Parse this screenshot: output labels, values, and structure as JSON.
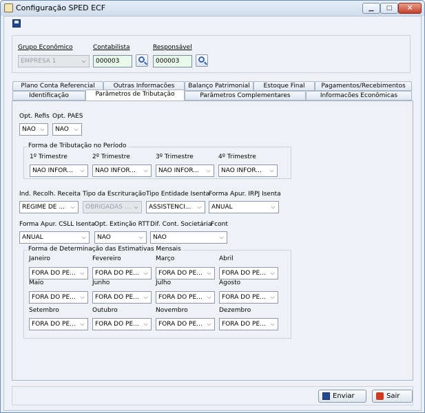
{
  "window": {
    "title": "Configuração SPED ECF",
    "minimize": "▁",
    "maximize": "□",
    "close": "✕"
  },
  "top": {
    "grupo_label": "Grupo Econômico",
    "grupo_value": "EMPRESA 1",
    "contabilista_label": "Contabilista",
    "contabilista_value": "000003",
    "responsavel_label": "Responsável",
    "responsavel_value": "000003"
  },
  "tabs": {
    "row1": [
      "Plano Conta Referencial",
      "Outras Informacões",
      "Balanço Patrimonial",
      "Estoque Final",
      "Pagamentos/Recebimentos"
    ],
    "row2": [
      "Identificação",
      "Parâmetros de Tributação",
      "Parâmetros Complementares",
      "Informacões Econômicas"
    ]
  },
  "form": {
    "opt_refis_label": "Opt. Refis",
    "opt_refis_value": "NAO",
    "opt_paes_label": "Opt. PAES",
    "opt_paes_value": "NAO",
    "forma_trib_title": "Forma de Tributação no Período",
    "trimestres": [
      {
        "label": "1º Trimestre",
        "value": "NAO INFOR..."
      },
      {
        "label": "2º Trimestre",
        "value": "NAO INFOR..."
      },
      {
        "label": "3º Trimestre",
        "value": "NAO INFOR..."
      },
      {
        "label": "4º Trimestre",
        "value": "NAO INFOR..."
      }
    ],
    "ind_recolh_label": "Ind. Recolh. Receita",
    "ind_recolh_value": "REGIME DE ...",
    "tipo_escrit_label": "Tipo da Escrituração",
    "tipo_escrit_value": "OBRIGADAS ...",
    "tipo_entidade_label": "Tipo Entidade Isenta",
    "tipo_entidade_value": "ASSISTENCI...",
    "forma_irpj_label": "Forma Apur. IRPJ Isenta",
    "forma_irpj_value": "ANUAL",
    "forma_csll_label": "Forma Apur. CSLL Isenta",
    "forma_csll_value": "ANUAL",
    "opt_rtt_label": "Opt. Extinção RTT",
    "opt_rtt_value": "NAO",
    "dif_cont_label": "Dif. Cont. Societária",
    "dif_cont_value": "NAO",
    "fcont_label": "Fcont",
    "estimativas_title": "Forma de Determinação das Estimativas Mensais",
    "meses": [
      {
        "label": "Janeiro",
        "value": "FORA DO PE..."
      },
      {
        "label": "Fevereiro",
        "value": "FORA DO PE..."
      },
      {
        "label": "Março",
        "value": "FORA DO PE..."
      },
      {
        "label": "Abril",
        "value": "FORA DO PE..."
      },
      {
        "label": "Maio",
        "value": "FORA DO PE..."
      },
      {
        "label": "Junho",
        "value": "FORA DO PE..."
      },
      {
        "label": "Julho",
        "value": "FORA DO PE..."
      },
      {
        "label": "Agosto",
        "value": "FORA DO PE..."
      },
      {
        "label": "Setembro",
        "value": "FORA DO PE..."
      },
      {
        "label": "Outubro",
        "value": "FORA DO PE..."
      },
      {
        "label": "Novembro",
        "value": "FORA DO PE..."
      },
      {
        "label": "Dezembro",
        "value": "FORA DO PE..."
      }
    ]
  },
  "footer": {
    "enviar": "Enviar",
    "sair": "Sair"
  },
  "arrow": "⌵"
}
